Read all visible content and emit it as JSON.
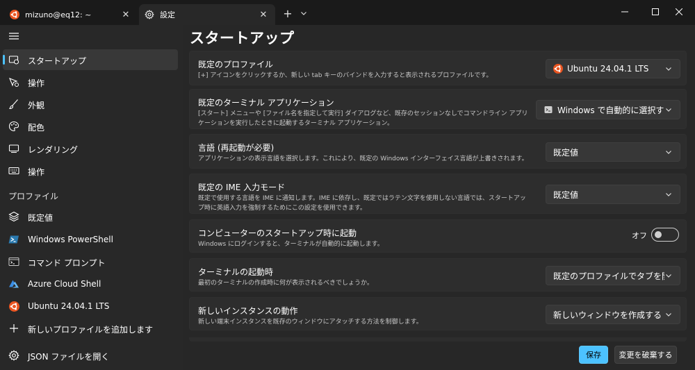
{
  "tabs": [
    {
      "title": "mizuno@eq12: ~",
      "icon": "ubuntu-icon",
      "active": false
    },
    {
      "title": "設定",
      "icon": "gear-icon",
      "active": true
    }
  ],
  "titlebar": {
    "new_tab": "+",
    "dropdown": "chevron-down-icon"
  },
  "window_controls": [
    "minimize-icon",
    "maximize-icon",
    "close-icon"
  ],
  "colors": {
    "accent": "#4cc2ff",
    "ubuntu": "#e95420",
    "background": "#202020"
  },
  "sidebar": {
    "items": [
      {
        "label": "スタートアップ",
        "icon": "startup-icon",
        "selected": true
      },
      {
        "label": "操作",
        "icon": "interaction-icon"
      },
      {
        "label": "外観",
        "icon": "brush-icon"
      },
      {
        "label": "配色",
        "icon": "palette-icon"
      },
      {
        "label": "レンダリング",
        "icon": "monitor-icon"
      },
      {
        "label": "操作",
        "icon": "keyboard-icon"
      }
    ],
    "profiles_header": "プロファイル",
    "profiles": [
      {
        "label": "既定値",
        "icon": "layers-icon"
      },
      {
        "label": "Windows PowerShell",
        "icon": "powershell-icon"
      },
      {
        "label": "コマンド プロンプト",
        "icon": "cmd-icon"
      },
      {
        "label": "Azure Cloud Shell",
        "icon": "azure-icon"
      },
      {
        "label": "Ubuntu 24.04.1 LTS",
        "icon": "ubuntu-icon"
      },
      {
        "label": "新しいプロファイルを追加します",
        "icon": "plus-icon"
      }
    ],
    "open_json": {
      "label": "JSON ファイルを開く",
      "icon": "gear-icon"
    }
  },
  "main": {
    "title": "スタートアップ",
    "settings": [
      {
        "title": "既定のプロファイル",
        "description": "[+] アイコンをクリックするか、新しい tab キーのバインドを入力すると表示されるプロファイルです。",
        "control": "combo",
        "value": "Ubuntu 24.04.1 LTS",
        "value_icon": "ubuntu-icon"
      },
      {
        "title": "既定のターミナル アプリケーション",
        "description": "[スタート] メニューや [ファイル名を指定して実行] ダイアログなど、既存のセッションなしでコマンドライン アプリケーションを実行したときに起動するターミナル アプリケーション。",
        "control": "combo",
        "value": "Windows で自動的に選択する",
        "value_icon": "terminal-app-icon"
      },
      {
        "title": "言語 (再起動が必要)",
        "description": "アプリケーションの表示言語を選択します。これにより、既定の Windows インターフェイス言語が上書きされます。",
        "control": "combo",
        "value": "既定値"
      },
      {
        "title": "既定の IME 入力モード",
        "description": "既定で使用する言語を IME に通知します。IME に依存し、既定ではラテン文字を使用しない言語では、スタートアップ時に英語入力を強制するためにこの設定を使用できます。",
        "control": "combo",
        "value": "既定値"
      },
      {
        "title": "コンピューターのスタートアップ時に起動",
        "description": "Windows にログインすると、ターミナルが自動的に起動します。",
        "control": "toggle",
        "value": "オフ"
      },
      {
        "title": "ターミナルの起動時",
        "description": "最初のターミナルの作成時に何が表示されるべきでしょうか。",
        "control": "combo",
        "value": "既定のプロファイルでタブを開く"
      },
      {
        "title": "新しいインスタンスの動作",
        "description": "新しい端末インスタンスを既存のウィンドウにアタッチする方法を制御します。",
        "control": "combo",
        "value": "新しいウィンドウを作成する"
      }
    ]
  },
  "footer": {
    "save": "保存",
    "discard": "変更を破棄する"
  }
}
